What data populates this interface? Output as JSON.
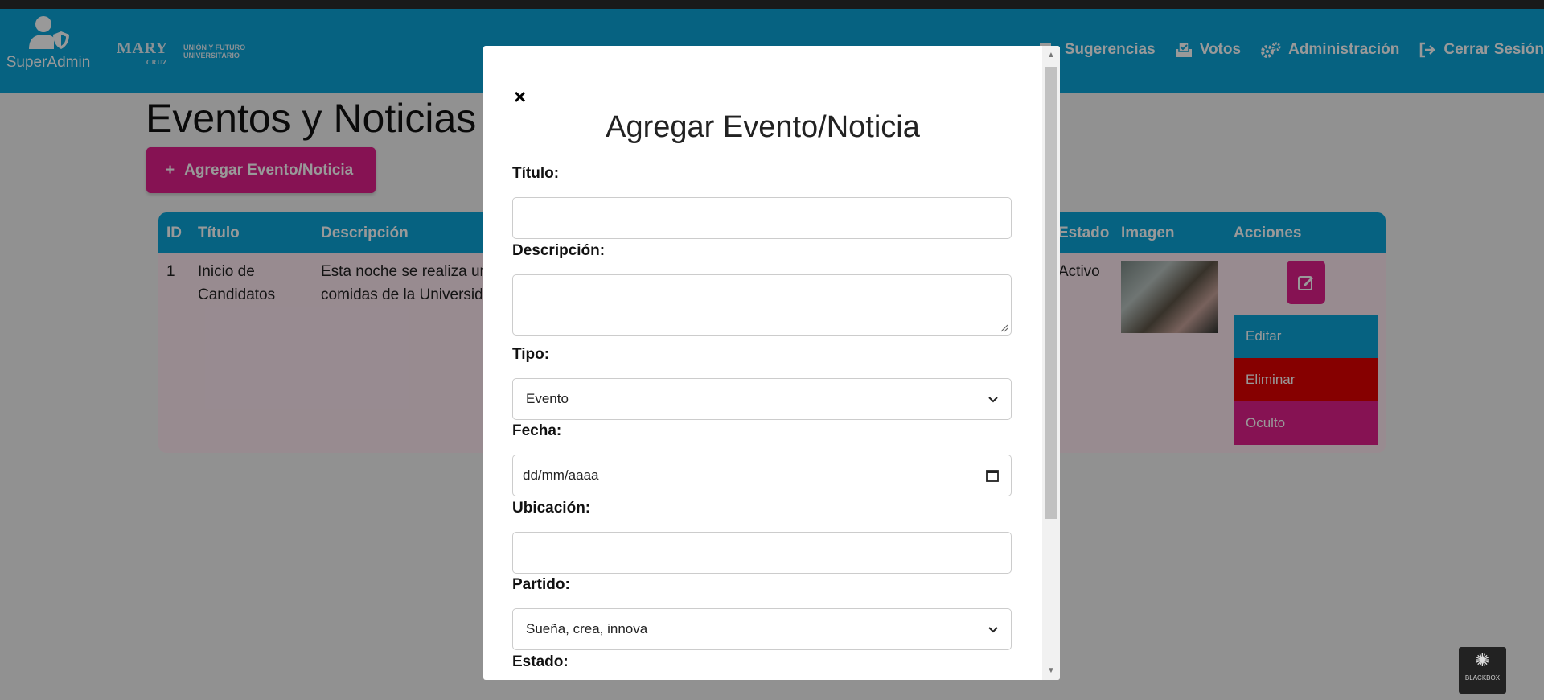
{
  "nav": {
    "brand_label": "SuperAdmin",
    "logo_main": "MARY",
    "logo_sub": "CRUZ",
    "logo_union_line1": "UNIÓN Y FUTURO",
    "logo_union_line2": "UNIVERSITARIO",
    "items": [
      {
        "label": "Sugerencias",
        "icon": "comments-icon"
      },
      {
        "label": "Votos",
        "icon": "vote-box-icon"
      },
      {
        "label": "Administración",
        "icon": "gears-icon"
      },
      {
        "label": "Cerrar Sesión",
        "icon": "sign-out-icon"
      }
    ]
  },
  "page": {
    "title": "Eventos y Noticias",
    "add_button": "Agregar Evento/Noticia"
  },
  "table": {
    "headers": {
      "id": "ID",
      "title": "Título",
      "description": "Descripción",
      "status": "Estado",
      "image": "Imagen",
      "actions": "Acciones"
    },
    "rows": [
      {
        "id": "1",
        "title_line1": "Inicio de",
        "title_line2": "Candidatos",
        "desc_line1": "Esta noche se realiza un",
        "desc_line2": "comidas de la Universid",
        "status": "Activo"
      }
    ],
    "action_menu": [
      "Editar",
      "Eliminar",
      "Oculto"
    ]
  },
  "modal": {
    "close": "×",
    "title": "Agregar Evento/Noticia",
    "fields": {
      "titulo_label": "Título:",
      "titulo_value": "",
      "descripcion_label": "Descripción:",
      "descripcion_value": "",
      "tipo_label": "Tipo:",
      "tipo_value": "Evento",
      "fecha_label": "Fecha:",
      "fecha_placeholder": "dd/mm/aaaa",
      "ubicacion_label": "Ubicación:",
      "ubicacion_value": "",
      "partido_label": "Partido:",
      "partido_value": "Sueña, crea, innova",
      "estado_label": "Estado:"
    }
  },
  "watermark": "BLACKBOX",
  "colors": {
    "primary": "#0aa3d8",
    "accent": "#e01f8a",
    "danger": "#e00000"
  }
}
